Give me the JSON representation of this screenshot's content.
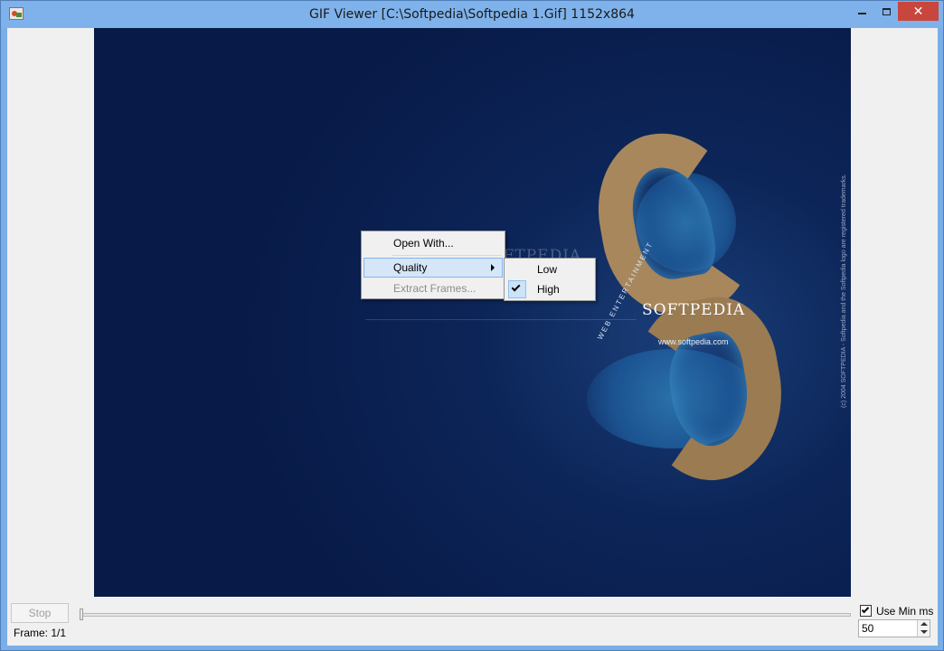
{
  "window": {
    "title": "GIF Viewer [C:\\Softpedia\\Softpedia 1.Gif] 1152x864",
    "close_glyph": "✕",
    "accent_color": "#7fb2ea"
  },
  "image": {
    "logo_text": "SOFTPEDIA",
    "url_text": "www.softpedia.com",
    "arc_text": "WEB ENTERTAINMENT",
    "copyright_text": "(c) 2004 SOFTPEDIA - Softpedia and the Softpedia logo are registered trademarks.",
    "watermark_text": "SOFTPEDIA"
  },
  "context_menu": {
    "items": [
      {
        "label": "Open With...",
        "enabled": true
      },
      {
        "label": "Quality",
        "enabled": true,
        "highlighted": true,
        "has_submenu": true
      },
      {
        "label": "Extract Frames...",
        "enabled": false
      }
    ],
    "quality_submenu": [
      {
        "label": "Low",
        "checked": false
      },
      {
        "label": "High",
        "checked": true
      }
    ]
  },
  "controls": {
    "stop_label": "Stop",
    "frame_label": "Frame: 1/1",
    "use_min_ms_label": "Use Min ms",
    "use_min_ms_checked": true,
    "min_ms_value": "50",
    "slider_position": 0
  }
}
